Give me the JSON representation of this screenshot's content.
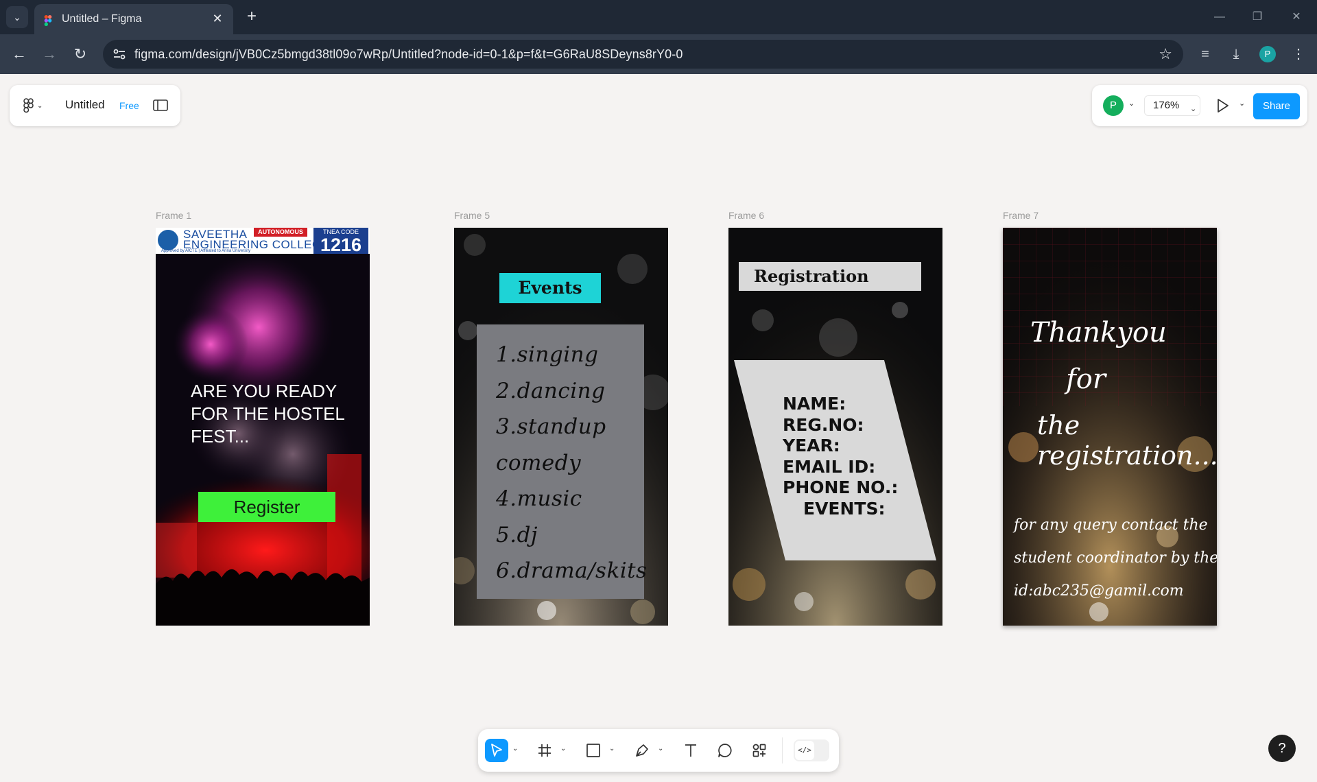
{
  "browser": {
    "tab_title": "Untitled – Figma",
    "url": "figma.com/design/jVB0Cz5bmgd38tl09o7wRp/Untitled?node-id=0-1&p=f&t=G6RaU8SDeyns8rY0-0",
    "profile_initial": "P"
  },
  "figma": {
    "file_name": "Untitled",
    "plan": "Free",
    "avatar_initial": "P",
    "zoom": "176%",
    "share_label": "Share",
    "help_label": "?"
  },
  "frames": [
    {
      "label": "Frame 1",
      "college_line1": "SAVEETHA",
      "college_line2": "ENGINEERING COLLEGE",
      "college_sub": "Approved by AICTE | Affiliated to Anna University",
      "autonomous": "AUTONOMOUS",
      "tnea_label": "TNEA CODE",
      "tnea_code": "1216",
      "headline_1": "ARE YOU  READY",
      "headline_2": "FOR THE HOSTEL",
      "headline_3": "FEST...",
      "button": "Register"
    },
    {
      "label": "Frame 5",
      "title": "Events",
      "items": [
        "1.singing",
        "2.dancing",
        "3.standup",
        "comedy",
        "4.music",
        "5.dj",
        "6.drama/skits"
      ]
    },
    {
      "label": "Frame 6",
      "title": "Registration",
      "fields": [
        "NAME:",
        "REG.NO:",
        "YEAR:",
        "EMAIL ID:",
        "PHONE NO.:",
        "EVENTS:"
      ]
    },
    {
      "label": "Frame 7",
      "thanks_1": "Thankyou",
      "thanks_2": "for",
      "thanks_3": "the registration....",
      "contact_1": "for any query contact the",
      "contact_2": "student coordinator by the email",
      "contact_3": "id:abc235@gamil.com"
    }
  ],
  "colors": {
    "figma_blue": "#0d99ff",
    "register_green": "#3ef03a",
    "events_cyan": "#1ed3d6",
    "avatar_green": "#14ae5c"
  }
}
